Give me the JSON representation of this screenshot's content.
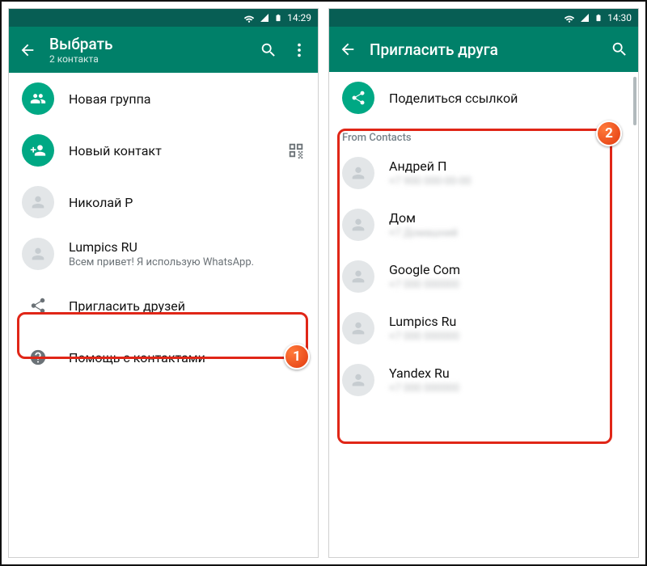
{
  "left": {
    "status": {
      "time": "14:29"
    },
    "appbar": {
      "title": "Выбрать",
      "subtitle": "2 контакта"
    },
    "rows": {
      "new_group": "Новая группа",
      "new_contact": "Новый контакт",
      "contact1": {
        "name": "Николай Р"
      },
      "contact2": {
        "name": "Lumpics RU",
        "sub": "Всем привет! Я использую WhatsApp."
      },
      "invite": "Пригласить друзей",
      "help": "Помощь с контактами"
    },
    "badge": "1"
  },
  "right": {
    "status": {
      "time": "14:30"
    },
    "appbar": {
      "title": "Пригласить друга"
    },
    "share_link": "Поделиться ссылкой",
    "section": "From Contacts",
    "contacts": [
      {
        "name": "Андрей П",
        "sub": "+7 900 000-00-00"
      },
      {
        "name": "Дом",
        "sub": "+7 Домашний"
      },
      {
        "name": "Google Com",
        "sub": "+7 000 000000"
      },
      {
        "name": "Lumpics Ru",
        "sub": "+7 000 000000"
      },
      {
        "name": "Yandex Ru",
        "sub": "+7 000 000000"
      }
    ],
    "badge": "2"
  }
}
